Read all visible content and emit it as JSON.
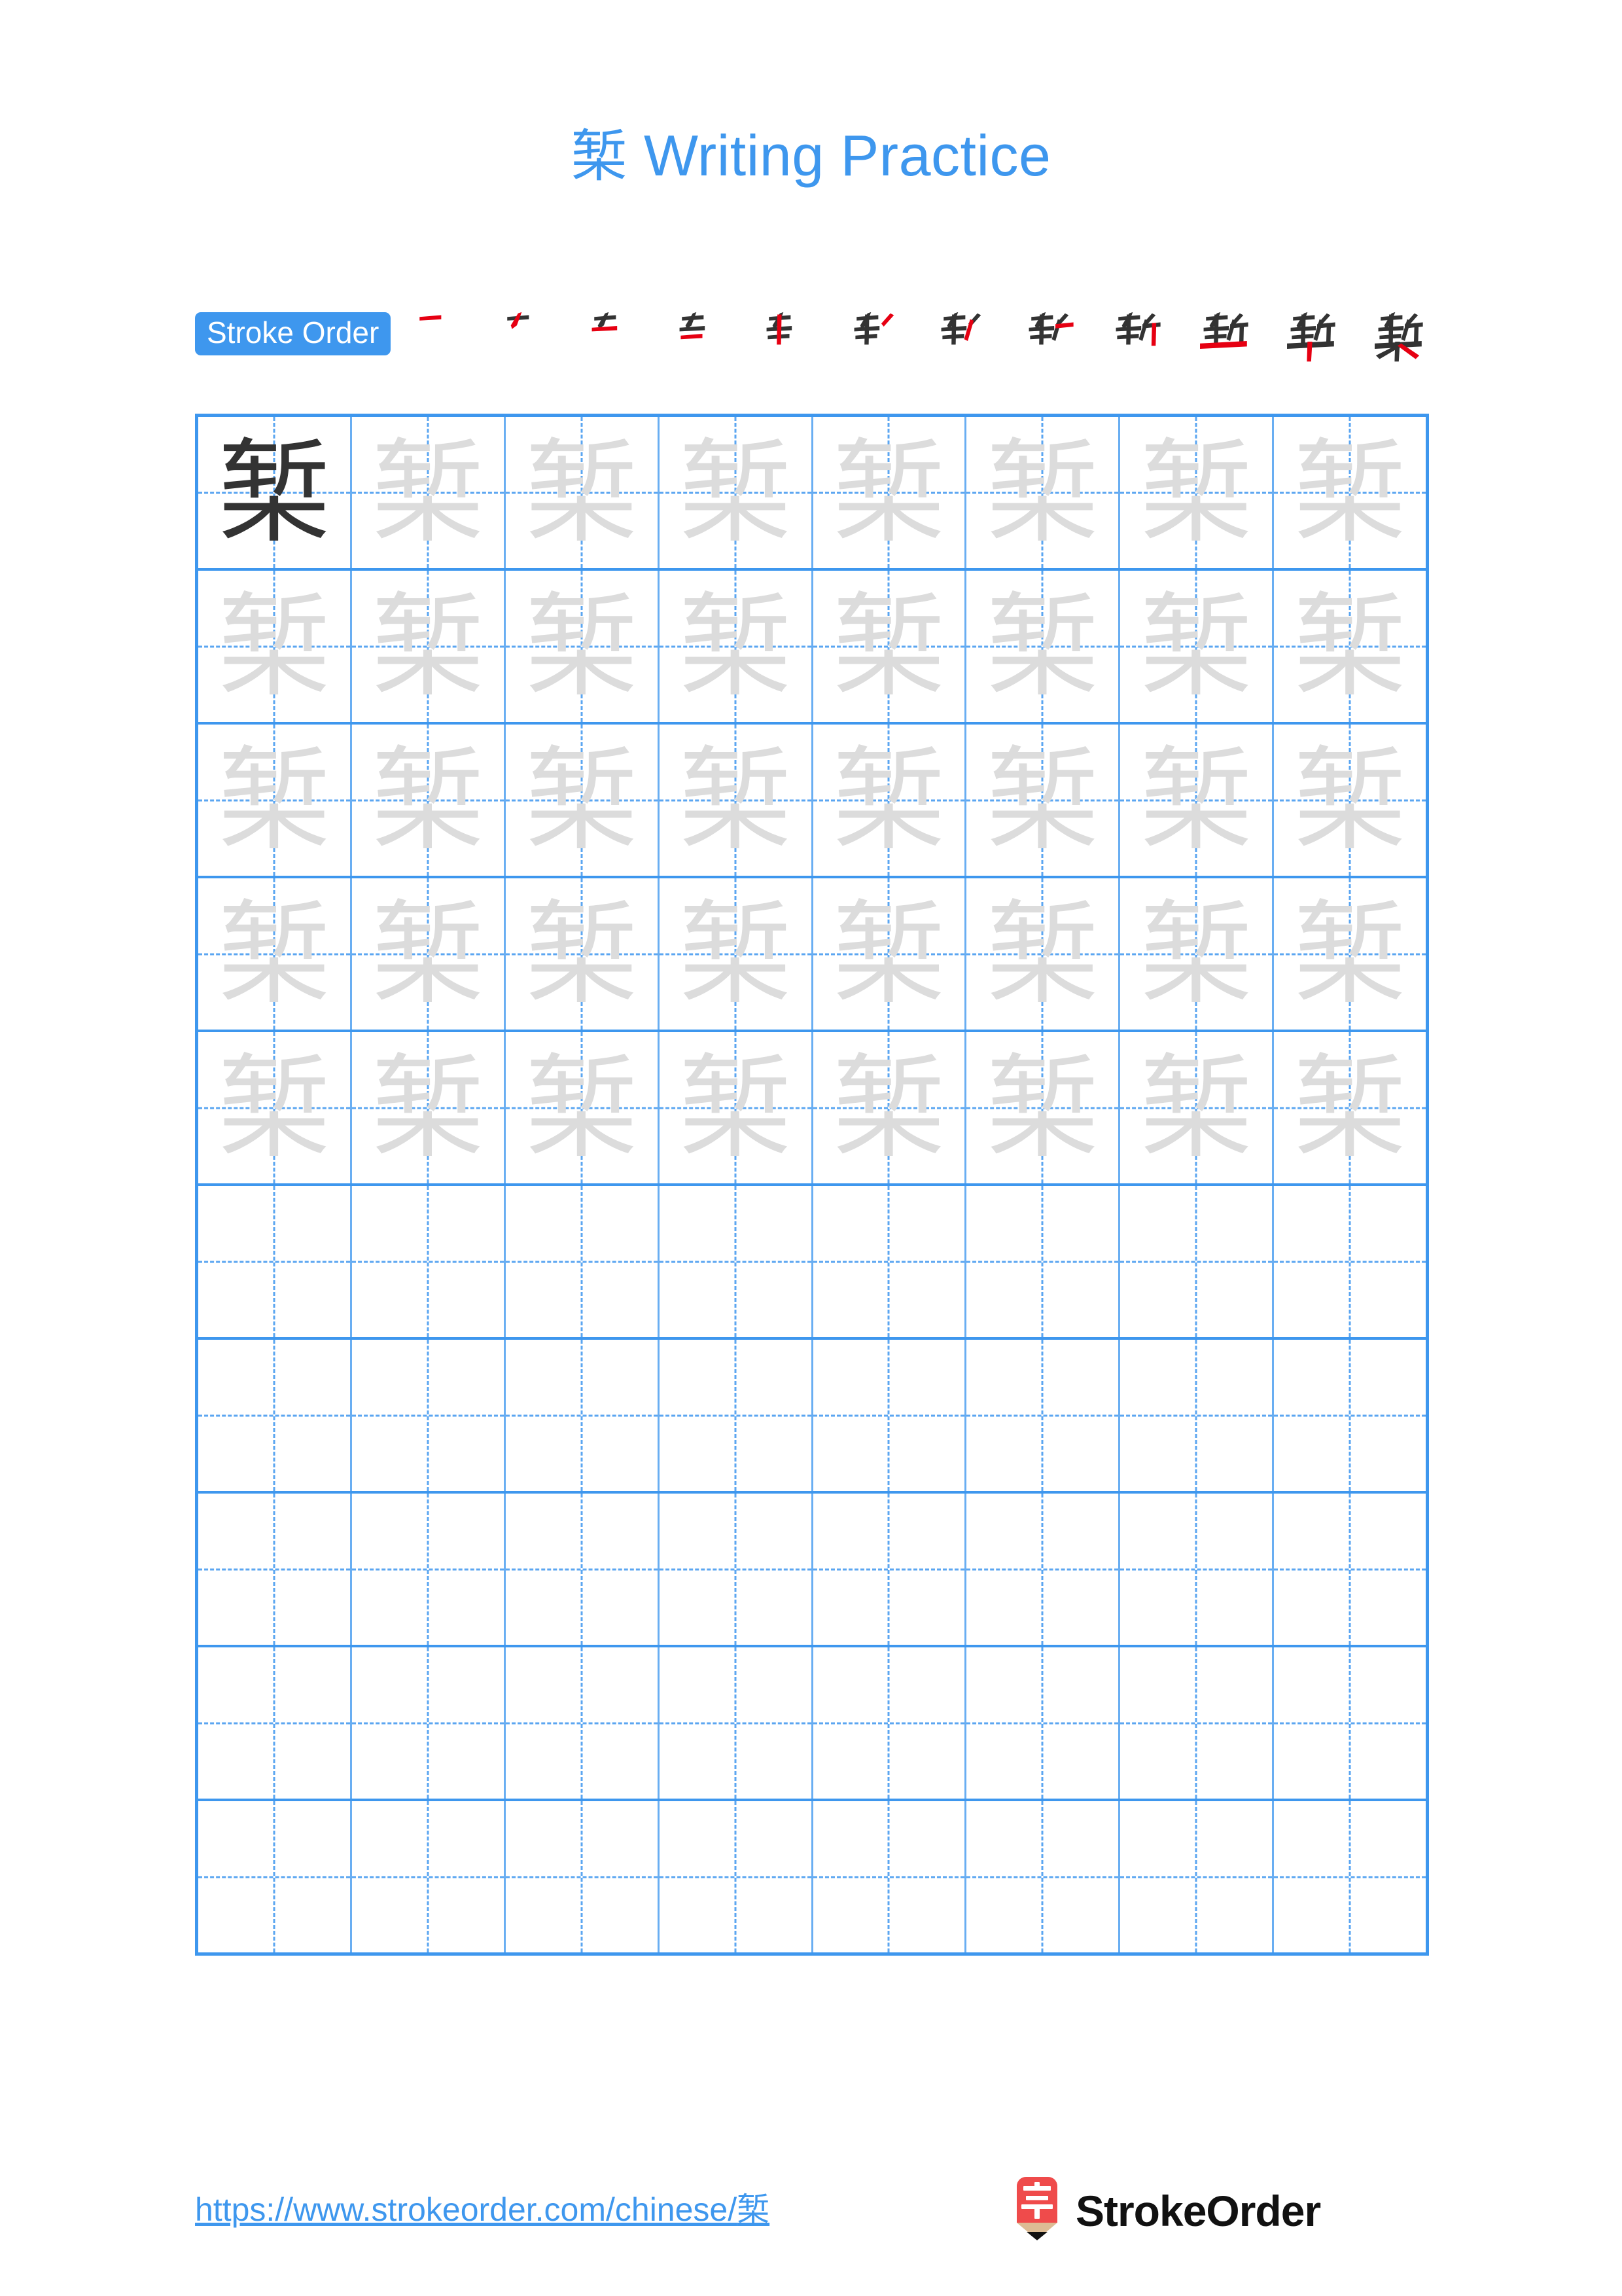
{
  "page": {
    "character": "椠",
    "title_suffix": " Writing Practice",
    "accent_color": "#3E97EE",
    "grid_line_color": "#69AEF2",
    "ghost_char_color": "#DCDCDC",
    "dark_char_color": "#333333",
    "stroke_highlight_color": "#E60012"
  },
  "title": {
    "character": "椠",
    "text": " Writing Practice"
  },
  "stroke_order": {
    "badge_label": "Stroke Order",
    "total_strokes": 12,
    "steps": [
      {
        "index": 1,
        "label": "一"
      },
      {
        "index": 2,
        "label": "𠂉"
      },
      {
        "index": 3,
        "label": "车"
      },
      {
        "index": 4,
        "label": "车"
      },
      {
        "index": 5,
        "label": "车丿"
      },
      {
        "index": 6,
        "label": "轩"
      },
      {
        "index": 7,
        "label": "轩"
      },
      {
        "index": 8,
        "label": "斩"
      },
      {
        "index": 9,
        "label": "斩"
      },
      {
        "index": 10,
        "label": "斩十"
      },
      {
        "index": 11,
        "label": "椠"
      },
      {
        "index": 12,
        "label": "椠"
      }
    ]
  },
  "grid": {
    "columns": 8,
    "rows": 10,
    "traced_rows": 5,
    "blank_rows": 5,
    "first_cell_is_dark": true,
    "practice_character": "椠"
  },
  "footer": {
    "url_prefix": "https://www.strokeorder.com/chinese/",
    "url_character": "椠",
    "brand_name": "StrokeOrder",
    "logo_character": "字",
    "logo_color": "#EF4B4B",
    "logo_wood_color": "#DDBC94"
  }
}
